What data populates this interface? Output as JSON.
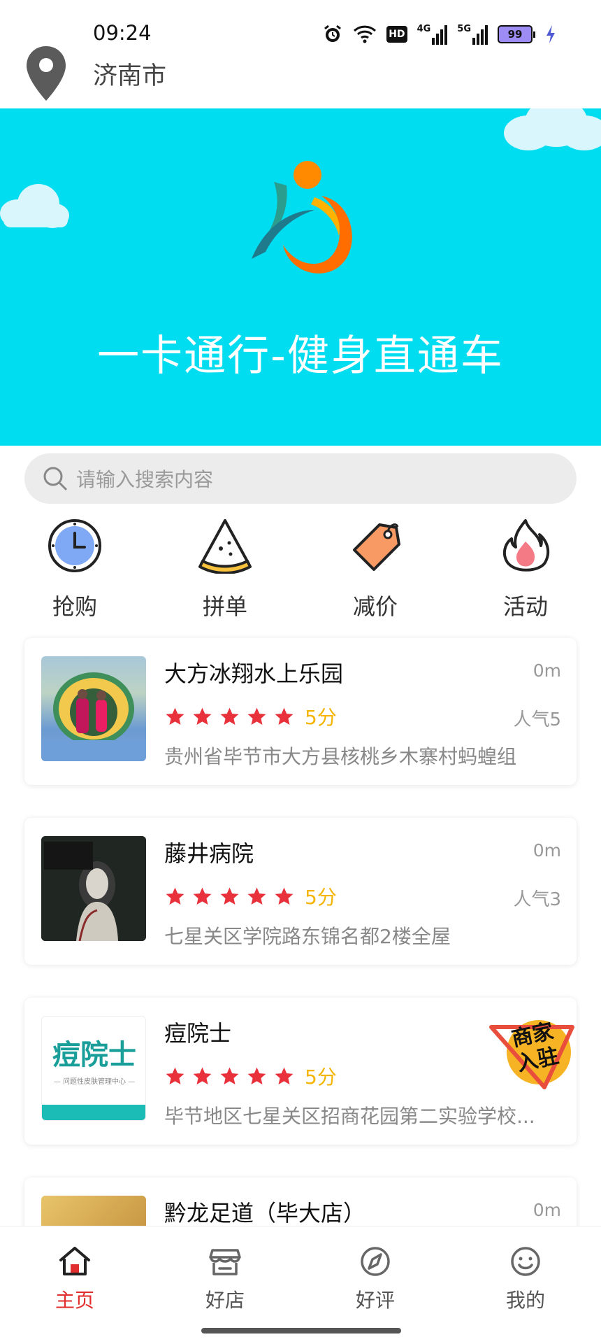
{
  "status_bar": {
    "time": "09:24",
    "network_hd": "HD",
    "network_4g": "4G",
    "network_5g": "5G",
    "battery": "99"
  },
  "header": {
    "city": "济南市"
  },
  "banner": {
    "title": "一卡通行-健身直通车",
    "background": "#00dcf0"
  },
  "search": {
    "placeholder": "请输入搜索内容"
  },
  "categories": [
    {
      "label": "抢购",
      "icon": "clock-icon"
    },
    {
      "label": "拼单",
      "icon": "pizza-slice-icon"
    },
    {
      "label": "减价",
      "icon": "price-tag-icon"
    },
    {
      "label": "活动",
      "icon": "fire-icon"
    }
  ],
  "shops": [
    {
      "name": "大方冰翔水上乐园",
      "distance": "0m",
      "score": "5分",
      "popularity": "人气5",
      "address": "贵州省毕节市大方县核桃乡木寨村蚂蝗组",
      "rating": 5
    },
    {
      "name": "藤井病院",
      "distance": "0m",
      "score": "5分",
      "popularity": "人气3",
      "address": "七星关区学院路东锦名都2楼全屋",
      "rating": 5
    },
    {
      "name": "痘院士",
      "distance": "",
      "score": "5分",
      "popularity": "",
      "address": "毕节地区七星关区招商花园第二实验学校...",
      "rating": 5,
      "thumb_brand": "痘院士",
      "thumb_sub": "— 问题性皮肤管理中心 —",
      "badge_line1": "商家",
      "badge_line2": "入驻"
    },
    {
      "name": "黔龙足道（毕大店）",
      "distance": "0m"
    }
  ],
  "tabs": [
    {
      "label": "主页",
      "icon": "home-icon",
      "active": true
    },
    {
      "label": "好店",
      "icon": "store-icon",
      "active": false
    },
    {
      "label": "好评",
      "icon": "compass-icon",
      "active": false
    },
    {
      "label": "我的",
      "icon": "smile-icon",
      "active": false
    }
  ],
  "colors": {
    "accent": "#e02d2d",
    "star": "#e8313a",
    "score": "#f4b400"
  }
}
